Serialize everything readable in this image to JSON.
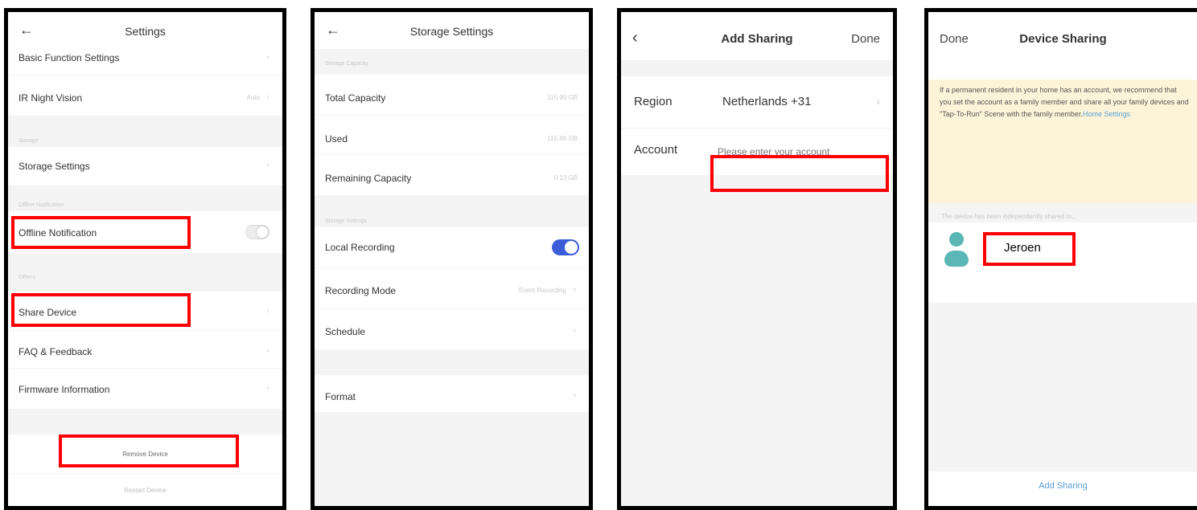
{
  "panel1": {
    "title": "Settings",
    "rows": {
      "basic_function": "Basic Function Settings",
      "ir_night_vision": "IR Night Vision",
      "ir_night_vision_value": "Auto",
      "storage_settings": "Storage Settings",
      "offline_notification": "Offline Notification",
      "share_device": "Share Device",
      "faq_feedback": "FAQ & Feedback",
      "firmware_information": "Firmware Information"
    },
    "sections": {
      "storage": "Storage",
      "offline": "Offline Notification",
      "others": "Others"
    },
    "offline_toggle_on": false,
    "remove_device": "Remove Device",
    "restart_device": "Restart Device"
  },
  "panel2": {
    "title": "Storage Settings",
    "sections": {
      "storage_capacity": "Storage Capacity",
      "storage_settings": "Storage Settings"
    },
    "rows": {
      "total_capacity": "Total Capacity",
      "total_capacity_value": "115.99 GB",
      "used": "Used",
      "used_value": "115.86 GB",
      "remaining_capacity": "Remaining Capacity",
      "remaining_capacity_value": "0.13 GB",
      "local_recording": "Local Recording",
      "recording_mode": "Recording Mode",
      "recording_mode_value": "Event Recording",
      "schedule": "Schedule",
      "format": "Format"
    },
    "local_recording_on": true
  },
  "panel3": {
    "title": "Add Sharing",
    "done": "Done",
    "region_label": "Region",
    "region_value": "Netherlands +31",
    "account_label": "Account",
    "account_placeholder": "Please enter your account"
  },
  "panel4": {
    "done": "Done",
    "title": "Device Sharing",
    "banner_text": "If a permanent resident in your home has an account, we recommend that you set the account as a family member and share all your family devices and \"Tap-To-Run\" Scene with the family member.",
    "banner_link": "Home Settings",
    "shared_caption": "The device has been independently shared to...",
    "shared_user": "Jeroen",
    "add_sharing": "Add Sharing"
  },
  "colors": {
    "highlight": "#ff0000",
    "toggle_on": "#3b5ed8",
    "banner_bg": "#fdf3d8",
    "avatar": "#5ab7b5",
    "link": "#5a9fd6"
  }
}
